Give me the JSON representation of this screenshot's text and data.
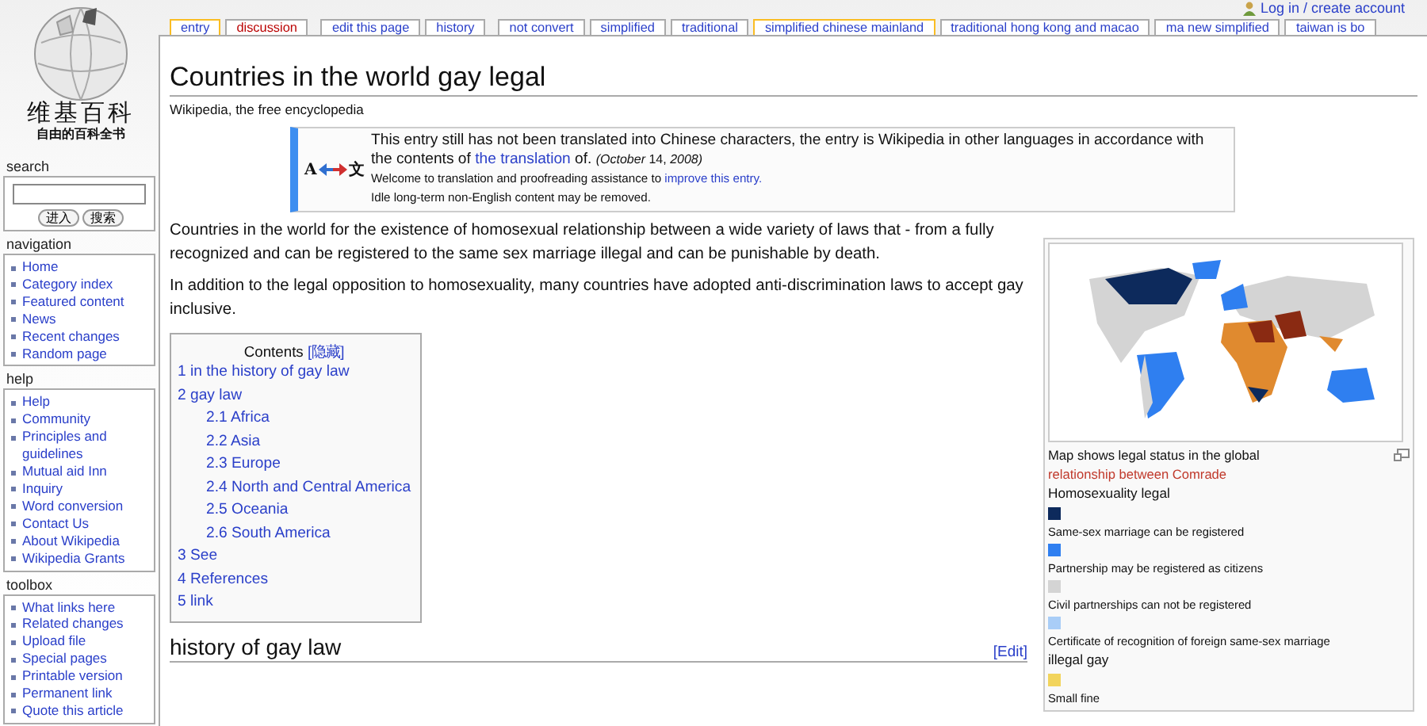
{
  "logo": {
    "title": "维基百科",
    "slogan": "自由的百科全书"
  },
  "search": {
    "heading": "search",
    "buttons": [
      "进入",
      "搜索"
    ]
  },
  "portlets": [
    {
      "heading": "navigation",
      "items": [
        "Home",
        "Category index",
        "Featured content",
        "News",
        "Recent changes",
        "Random page"
      ]
    },
    {
      "heading": "help",
      "items": [
        "Help",
        "Community",
        "Principles and guidelines",
        "Mutual aid Inn",
        "Inquiry",
        "Word conversion",
        "Contact Us",
        "About Wikipedia",
        "Wikipedia Grants"
      ]
    },
    {
      "heading": "toolbox",
      "items": [
        "What links here",
        "Related changes",
        "Upload file",
        "Special pages",
        "Printable version",
        "Permanent link",
        "Quote this article"
      ]
    }
  ],
  "user_link": "Log in / create account",
  "tab_groups": [
    {
      "tabs": [
        {
          "label": "entry",
          "selected": true,
          "missing": false
        },
        {
          "label": "discussion",
          "selected": false,
          "missing": true
        }
      ]
    },
    {
      "tabs": [
        {
          "label": "edit this page",
          "selected": false,
          "missing": false
        },
        {
          "label": "history",
          "selected": false,
          "missing": false
        }
      ]
    },
    {
      "tabs": [
        {
          "label": "not convert",
          "selected": false,
          "missing": false
        },
        {
          "label": "simplified",
          "selected": false,
          "missing": false
        },
        {
          "label": "traditional",
          "selected": false,
          "missing": false
        },
        {
          "label": "simplified chinese mainland",
          "selected": true,
          "missing": false
        },
        {
          "label": "traditional hong kong and macao",
          "selected": false,
          "missing": false
        },
        {
          "label": "ma new simplified",
          "selected": false,
          "missing": false
        },
        {
          "label": "taiwan is bo",
          "selected": false,
          "missing": false
        }
      ]
    }
  ],
  "page": {
    "title": "Countries in the world gay legal",
    "subtitle": "Wikipedia, the free encyclopedia"
  },
  "notice": {
    "icon_letters": [
      "A",
      "文"
    ],
    "message": {
      "text": "This entry still has not been translated into Chinese characters, the entry is Wikipedia in other languages in accordance with the contents of ",
      "link": "the translation",
      "after": " of. ",
      "date": "*(October* 14, *2008)*"
    },
    "notes": [
      {
        "text": "Welcome to translation and proofreading assistance to ",
        "link": "improve this entry."
      },
      {
        "text": "Idle long-term non-English content may be removed."
      }
    ]
  },
  "paragraphs": [
    "Countries in the world for the existence of homosexual relationship between a wide variety of laws that - from a fully recognized and can be registered to the same sex marriage illegal and can be punishable by death.",
    "In addition to the legal opposition to homosexuality, many countries have adopted anti-discrimination laws to accept gay inclusive."
  ],
  "toc": {
    "title": "Contents",
    "toggle": "[隐藏]",
    "items": [
      {
        "label": "1 in the history of gay law"
      },
      {
        "label": "2 gay law",
        "children": [
          {
            "label": "2.1 Africa"
          },
          {
            "label": "2.2 Asia"
          },
          {
            "label": "2.3 Europe"
          },
          {
            "label": "2.4 North and Central America"
          },
          {
            "label": "2.5 Oceania"
          },
          {
            "label": "2.6 South America"
          }
        ]
      },
      {
        "label": "3 See"
      },
      {
        "label": "4 References"
      },
      {
        "label": "5 link"
      }
    ]
  },
  "section": {
    "heading": "history of gay law",
    "edit": "[Edit]"
  },
  "infobox": {
    "caption": "Map shows legal status in the global ",
    "caption_link": "relationship between Comrade",
    "legend": [
      {
        "kind": "heading",
        "label": "Homosexuality legal"
      },
      {
        "kind": "swatch",
        "label": "Same-sex marriage can be registered",
        "color": "#0d2a5c"
      },
      {
        "kind": "swatch",
        "label": "Partnership may be registered as citizens",
        "color": "#2f7ff0"
      },
      {
        "kind": "swatch",
        "label": "Civil partnerships can not be registered",
        "color": "#d4d4d4"
      },
      {
        "kind": "swatch",
        "label": "Certificate of recognition of foreign same-sex marriage",
        "color": "#a9cdf7"
      },
      {
        "kind": "heading",
        "label": "illegal gay"
      },
      {
        "kind": "swatch",
        "label": "Small fine",
        "color": "#f2d45c"
      }
    ]
  }
}
